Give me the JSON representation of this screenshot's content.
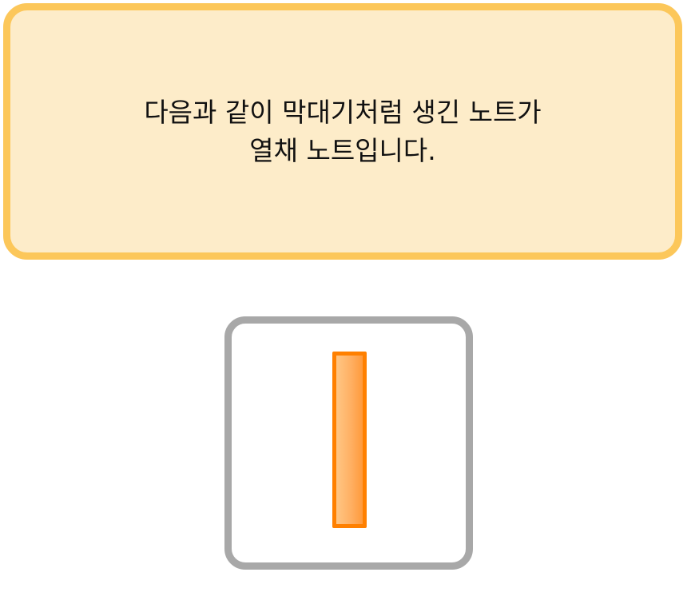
{
  "callout": {
    "line1": "다음과 같이 막대기처럼 생긴 노트가",
    "line2": "열채 노트입니다."
  },
  "colors": {
    "callout_fill": "#fdecc9",
    "callout_border": "#fcc75a",
    "frame_border": "#a8a8a8",
    "note_border": "#ff8000",
    "note_fill": "#ffb063"
  },
  "icons": {
    "note": "long-note-bar-icon"
  }
}
